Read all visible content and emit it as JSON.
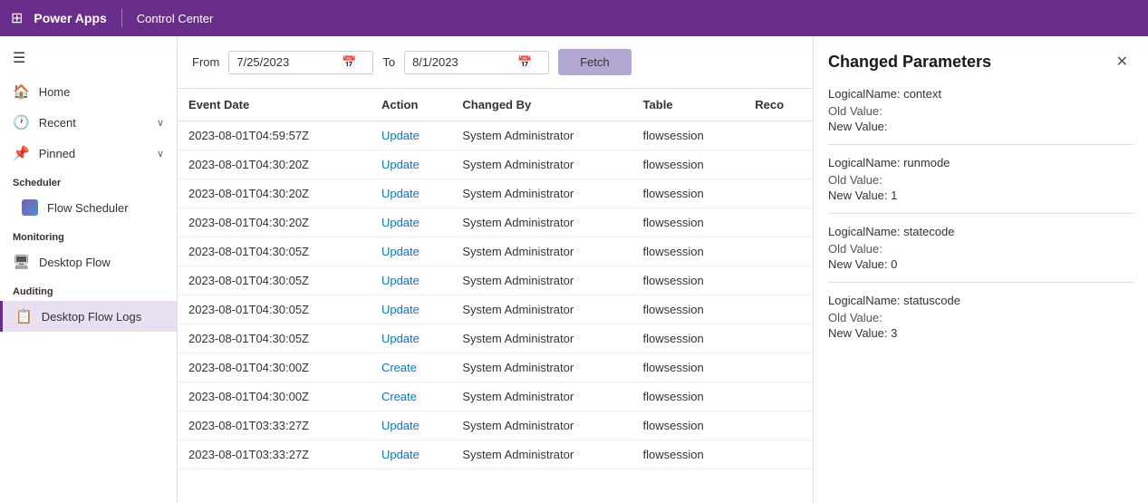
{
  "topbar": {
    "app_name": "Power Apps",
    "divider": "|",
    "section_name": "Control Center"
  },
  "sidebar": {
    "hamburger_icon": "☰",
    "items": [
      {
        "id": "home",
        "label": "Home",
        "icon": "🏠",
        "has_chevron": false
      },
      {
        "id": "recent",
        "label": "Recent",
        "icon": "🕐",
        "has_chevron": true
      },
      {
        "id": "pinned",
        "label": "Pinned",
        "icon": "📌",
        "has_chevron": true
      }
    ],
    "sections": [
      {
        "label": "Scheduler",
        "items": [
          {
            "id": "flow-scheduler",
            "label": "Flow Scheduler",
            "icon": "scheduler"
          }
        ]
      },
      {
        "label": "Monitoring",
        "items": [
          {
            "id": "desktop-flow",
            "label": "Desktop Flow",
            "icon": "🖥"
          }
        ]
      },
      {
        "label": "Auditing",
        "items": [
          {
            "id": "desktop-flow-logs",
            "label": "Desktop Flow Logs",
            "icon": "📋",
            "active": true
          }
        ]
      }
    ]
  },
  "filter": {
    "from_label": "From",
    "from_value": "7/25/2023",
    "to_label": "To",
    "to_value": "8/1/2023",
    "fetch_label": "Fetch"
  },
  "table": {
    "columns": [
      "Event Date",
      "Action",
      "Changed By",
      "Table",
      "Reco"
    ],
    "rows": [
      {
        "event_date": "2023-08-01T04:59:57Z",
        "action": "Update",
        "changed_by": "System Administrator",
        "table": "flowsession",
        "record": ""
      },
      {
        "event_date": "2023-08-01T04:30:20Z",
        "action": "Update",
        "changed_by": "System Administrator",
        "table": "flowsession",
        "record": ""
      },
      {
        "event_date": "2023-08-01T04:30:20Z",
        "action": "Update",
        "changed_by": "System Administrator",
        "table": "flowsession",
        "record": ""
      },
      {
        "event_date": "2023-08-01T04:30:20Z",
        "action": "Update",
        "changed_by": "System Administrator",
        "table": "flowsession",
        "record": ""
      },
      {
        "event_date": "2023-08-01T04:30:05Z",
        "action": "Update",
        "changed_by": "System Administrator",
        "table": "flowsession",
        "record": ""
      },
      {
        "event_date": "2023-08-01T04:30:05Z",
        "action": "Update",
        "changed_by": "System Administrator",
        "table": "flowsession",
        "record": ""
      },
      {
        "event_date": "2023-08-01T04:30:05Z",
        "action": "Update",
        "changed_by": "System Administrator",
        "table": "flowsession",
        "record": ""
      },
      {
        "event_date": "2023-08-01T04:30:05Z",
        "action": "Update",
        "changed_by": "System Administrator",
        "table": "flowsession",
        "record": ""
      },
      {
        "event_date": "2023-08-01T04:30:00Z",
        "action": "Create",
        "changed_by": "System Administrator",
        "table": "flowsession",
        "record": ""
      },
      {
        "event_date": "2023-08-01T04:30:00Z",
        "action": "Create",
        "changed_by": "System Administrator",
        "table": "flowsession",
        "record": ""
      },
      {
        "event_date": "2023-08-01T03:33:27Z",
        "action": "Update",
        "changed_by": "System Administrator",
        "table": "flowsession",
        "record": ""
      },
      {
        "event_date": "2023-08-01T03:33:27Z",
        "action": "Update",
        "changed_by": "System Administrator",
        "table": "flowsession",
        "record": ""
      }
    ]
  },
  "side_panel": {
    "title": "Changed Parameters",
    "close_icon": "✕",
    "params": [
      {
        "logical_name": "LogicalName: context",
        "old_value": "Old Value:",
        "new_value": "New Value:"
      },
      {
        "logical_name": "LogicalName: runmode",
        "old_value": "Old Value:",
        "new_value": "New Value: 1"
      },
      {
        "logical_name": "LogicalName: statecode",
        "old_value": "Old Value:",
        "new_value": "New Value: 0"
      },
      {
        "logical_name": "LogicalName: statuscode",
        "old_value": "Old Value:",
        "new_value": "New Value: 3"
      }
    ]
  }
}
